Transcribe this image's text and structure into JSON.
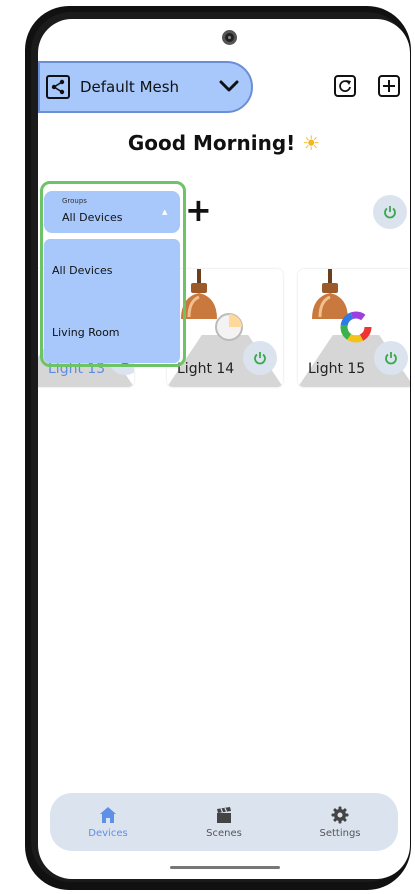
{
  "header": {
    "mesh_name": "Default Mesh",
    "greeting": "Good Morning!",
    "greeting_emoji": "☀"
  },
  "groups": {
    "label": "Groups",
    "selected": "All Devices",
    "options": [
      "All Devices",
      "Living Room"
    ],
    "add_label": "+"
  },
  "devices": [
    {
      "name": "Light 13",
      "bulb": "white"
    },
    {
      "name": "Light 14",
      "bulb": "white"
    },
    {
      "name": "Light 15",
      "bulb": "rgb"
    }
  ],
  "nav": {
    "items": [
      {
        "label": "Devices",
        "icon": "home-icon",
        "active": true
      },
      {
        "label": "Scenes",
        "icon": "clapperboard-icon",
        "active": false
      },
      {
        "label": "Settings",
        "icon": "gear-icon",
        "active": false
      }
    ]
  },
  "colors": {
    "accent": "#a8c8fb",
    "highlight": "#6cc466",
    "power_green": "#3aa84a"
  }
}
